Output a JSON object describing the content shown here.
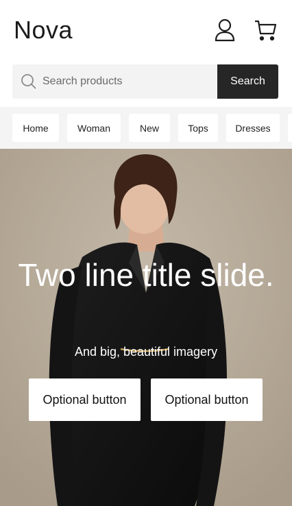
{
  "brand": {
    "name": "Nova"
  },
  "icons": {
    "account": "user-icon",
    "cart": "cart-icon",
    "search": "search-icon"
  },
  "search": {
    "placeholder": "Search products",
    "value": "",
    "button_label": "Search"
  },
  "categories": [
    {
      "label": "Home"
    },
    {
      "label": "Woman"
    },
    {
      "label": "New"
    },
    {
      "label": "Tops"
    },
    {
      "label": "Dresses"
    }
  ],
  "hero": {
    "title": "Two line title slide.",
    "subtitle": "And big, beautiful imagery",
    "buttons": [
      {
        "label": "Optional button"
      },
      {
        "label": "Optional button"
      }
    ]
  },
  "colors": {
    "text": "#1b1b1b",
    "search_button_bg": "#262626",
    "chip_strip_bg": "#f4f4f4",
    "hero_bg": "#b6aa99"
  }
}
